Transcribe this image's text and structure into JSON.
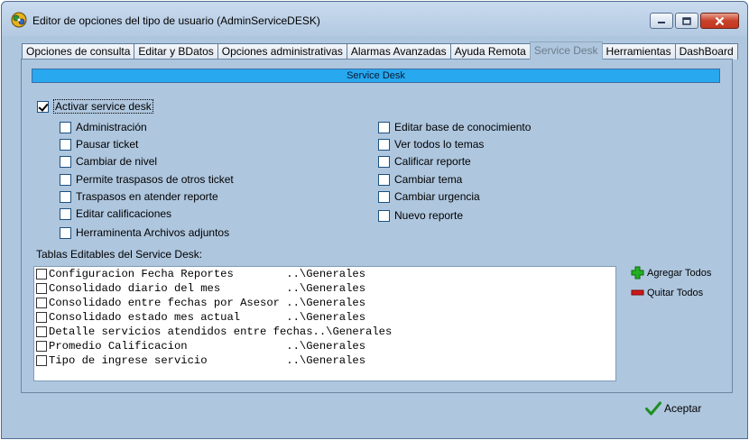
{
  "window": {
    "title": "Editor de opciones del tipo de usuario (AdminServiceDESK)",
    "icon": "puzzle-gear-icon"
  },
  "tabs": [
    {
      "label": "Opciones de consulta",
      "active": false
    },
    {
      "label": "Editar y BDatos",
      "active": false
    },
    {
      "label": "Opciones administrativas",
      "active": false
    },
    {
      "label": "Alarmas Avanzadas",
      "active": false
    },
    {
      "label": "Ayuda Remota",
      "active": false
    },
    {
      "label": "Service Desk",
      "active": true
    },
    {
      "label": "Herramientas",
      "active": false
    },
    {
      "label": "DashBoard",
      "active": false
    }
  ],
  "section": {
    "header": "Service Desk"
  },
  "activate": {
    "label": "Activar service desk",
    "checked": true
  },
  "options_left": [
    {
      "label": "Administración",
      "checked": false
    },
    {
      "label": "Pausar ticket",
      "checked": false
    },
    {
      "label": "Cambiar de nivel",
      "checked": false
    },
    {
      "label": "Permite traspasos de otros ticket",
      "checked": false
    },
    {
      "label": "Traspasos en atender reporte",
      "checked": false
    },
    {
      "label": "Editar calificaciones",
      "checked": false
    },
    {
      "label": "Herraminenta Archivos adjuntos",
      "checked": false
    }
  ],
  "options_right": [
    {
      "label": "Editar base de conocimiento",
      "checked": false
    },
    {
      "label": "Ver todos lo temas",
      "checked": false
    },
    {
      "label": "Calificar reporte",
      "checked": false
    },
    {
      "label": "Cambiar tema",
      "checked": false
    },
    {
      "label": "Cambiar urgencia",
      "checked": false
    },
    {
      "label": "Nuevo reporte",
      "checked": false
    }
  ],
  "tables": {
    "label": "Tablas Editables del Service Desk:",
    "rows": [
      {
        "text": "Configuracion Fecha Reportes        ..\\Generales",
        "checked": false
      },
      {
        "text": "Consolidado diario del mes          ..\\Generales",
        "checked": false
      },
      {
        "text": "Consolidado entre fechas por Asesor ..\\Generales",
        "checked": false
      },
      {
        "text": "Consolidado estado mes actual       ..\\Generales",
        "checked": false
      },
      {
        "text": "Detalle servicios atendidos entre fechas..\\Generales",
        "checked": false
      },
      {
        "text": "Promedio Calificacion               ..\\Generales",
        "checked": false
      },
      {
        "text": "Tipo de ingrese servicio            ..\\Generales",
        "checked": false
      }
    ]
  },
  "buttons": {
    "add_all": "Agregar Todos",
    "remove_all": "Quitar Todos",
    "accept": "Aceptar"
  },
  "colors": {
    "background": "#aec6de",
    "section_header": "#27a8ef",
    "add_icon": "#22b022",
    "remove_icon": "#d01818",
    "accept_icon": "#1f8f1f"
  }
}
